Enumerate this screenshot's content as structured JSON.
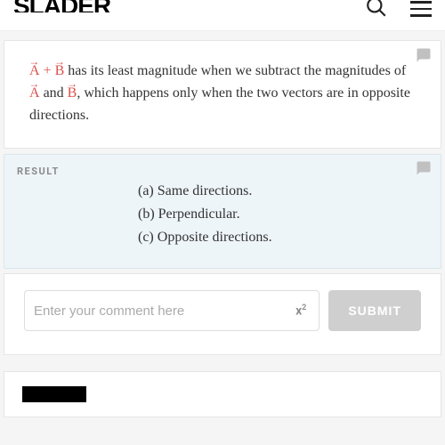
{
  "header": {
    "logo": "SLADER"
  },
  "explanation": {
    "vec_sum": "A + B",
    "text_1": " has its least magnitude when we subtract the magnitudes of ",
    "vec_a": "A",
    "text_2": " and ",
    "vec_b": "B",
    "text_3": ", which happens only when the two vectors are in opposite directions."
  },
  "result": {
    "label": "RESULT",
    "items": [
      "(a) Same directions.",
      "(b) Perpendicular.",
      "(c) Opposite directions."
    ]
  },
  "comment": {
    "placeholder": "Enter your comment here",
    "superscript": "x²",
    "submit": "SUBMIT"
  }
}
